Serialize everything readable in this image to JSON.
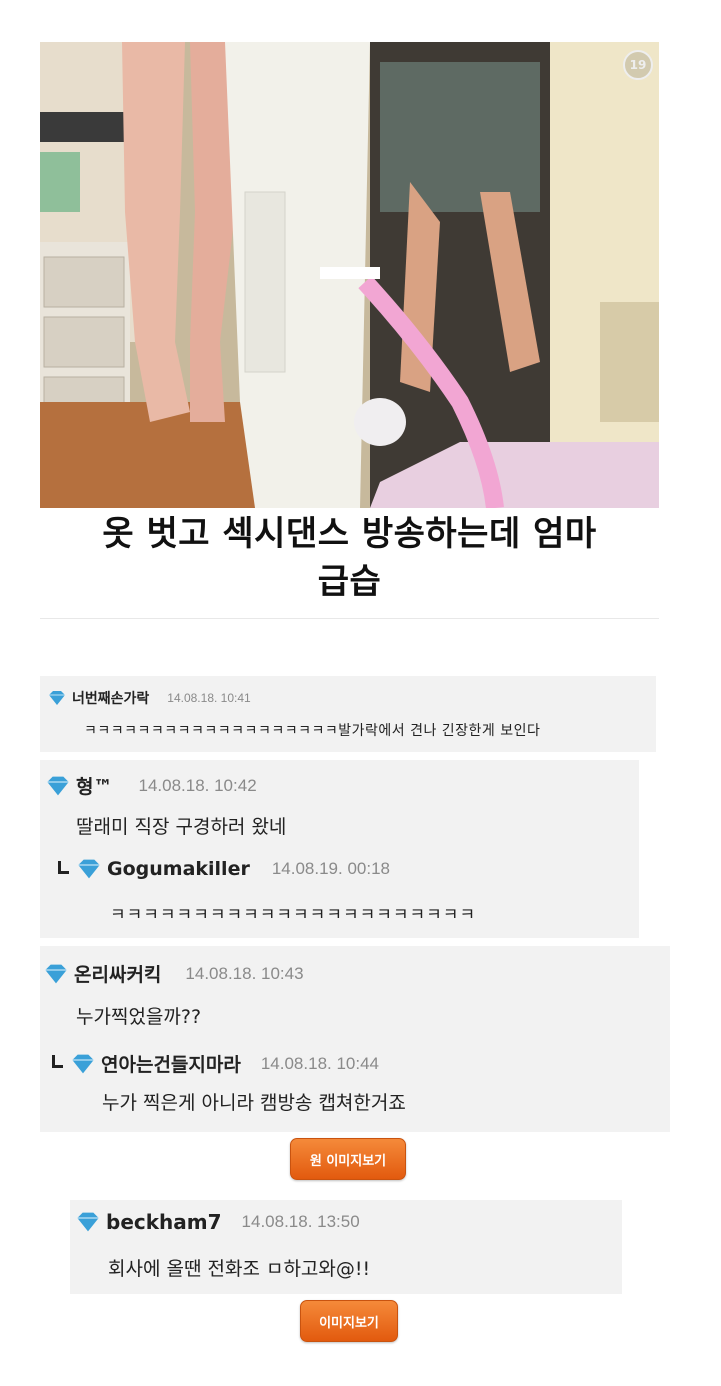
{
  "photo": {
    "age_badge": "19"
  },
  "headline": {
    "line1": "옷 벗고 섹시댄스 방송하는데 엄마",
    "line2": "급습"
  },
  "comments": [
    {
      "user": "너번째손가락",
      "date": "14.08.18. 10:41",
      "text": "ㅋㅋㅋㅋㅋㅋㅋㅋㅋㅋㅋㅋㅋㅋㅋㅋㅋㅋㅋ발가락에서 견나 긴장한게 보인다"
    },
    {
      "user": "형™",
      "date": "14.08.18. 10:42",
      "text": "딸래미 직장 구경하러 왔네",
      "reply": {
        "user": "Gogumakiller",
        "date": "14.08.19. 00:18",
        "text": "ㅋㅋㅋㅋㅋㅋㅋㅋㅋㅋㅋㅋㅋㅋㅋㅋㅋㅋㅋㅋㅋㅋ"
      }
    },
    {
      "user": "온리싸커킥",
      "date": "14.08.18. 10:43",
      "text": "누가찍었을까??",
      "reply": {
        "user": "연아는건들지마라",
        "date": "14.08.18. 10:44",
        "text": "누가 찍은게 아니라 캠방송 캡쳐한거죠"
      }
    }
  ],
  "button_original": "원 이미지보기",
  "comment_bottom": {
    "user": "beckham7",
    "date": "14.08.18. 13:50",
    "text": "회사에 올땐 전화조 ㅁ하고와@!!"
  },
  "button_image": "이미지보기",
  "colors": {
    "gem": "#3aa0d8",
    "button": "#e8661a",
    "panel": "#f2f2f2"
  },
  "icons": [
    "diamond-icon",
    "reply-arrow-icon"
  ]
}
